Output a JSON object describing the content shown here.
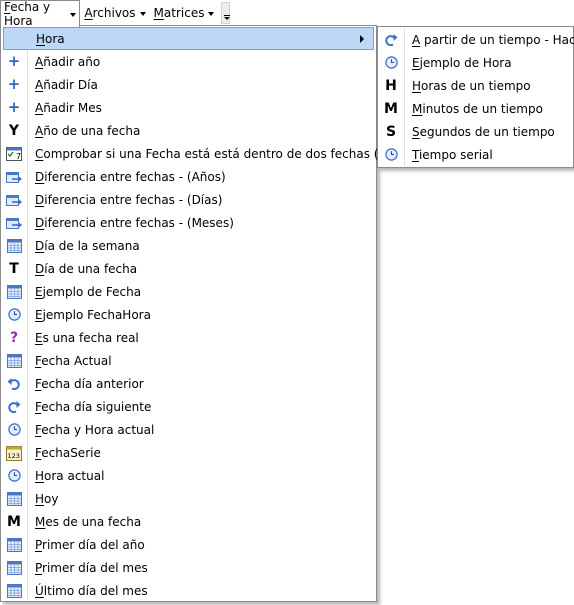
{
  "menubar": {
    "items": [
      {
        "label": "Fecha y Hora",
        "mnemonic": "F",
        "rest": "echa y Hora"
      },
      {
        "label": "Archivos",
        "mnemonic": "A",
        "rest": "rchivos"
      },
      {
        "label": "Matrices",
        "mnemonic": "M",
        "rest": "atrices"
      }
    ]
  },
  "main_menu": {
    "items": [
      {
        "icon": "none",
        "m": "H",
        "r": "ora",
        "has_submenu": true
      },
      {
        "icon": "plus-icon",
        "m": "A",
        "r": "ñadir año"
      },
      {
        "icon": "plus-icon",
        "m": "A",
        "r": "ñadir Día"
      },
      {
        "icon": "plus-icon",
        "m": "A",
        "r": "ñadir Mes"
      },
      {
        "icon": "y-letter-icon",
        "m": "A",
        "r": "ño de una fecha"
      },
      {
        "icon": "calendar-check-icon",
        "m": "C",
        "r": "omprobar si una Fecha está está dentro de dos fechas (fx)"
      },
      {
        "icon": "date-diff-icon",
        "m": "D",
        "r": "iferencia entre fechas - (Años)"
      },
      {
        "icon": "date-diff-icon",
        "m": "D",
        "r": "iferencia entre fechas - (Días)"
      },
      {
        "icon": "date-diff-icon",
        "m": "D",
        "r": "iferencia entre fechas - (Meses)"
      },
      {
        "icon": "calendar-icon",
        "m": "D",
        "r": "ía de la semana"
      },
      {
        "icon": "t-letter-icon",
        "m": "D",
        "r": "ía de una fecha"
      },
      {
        "icon": "calendar-icon",
        "m": "E",
        "r": "jemplo de Fecha"
      },
      {
        "icon": "clock-icon",
        "m": "E",
        "r": "jemplo FechaHora"
      },
      {
        "icon": "question-icon",
        "m": "E",
        "r": "s una fecha real"
      },
      {
        "icon": "calendar-icon",
        "m": "F",
        "r": "echa Actual"
      },
      {
        "icon": "undo-arrow-icon",
        "m": "F",
        "r": "echa día anterior"
      },
      {
        "icon": "redo-arrow-icon",
        "m": "F",
        "r": "echa día siguiente"
      },
      {
        "icon": "clock-icon",
        "m": "F",
        "r": "echa y Hora actual"
      },
      {
        "icon": "calendar-123-icon",
        "m": "F",
        "r": "echaSerie"
      },
      {
        "icon": "clock-icon",
        "m": "H",
        "r": "ora actual"
      },
      {
        "icon": "calendar-icon",
        "m": "H",
        "r": "oy"
      },
      {
        "icon": "m-letter-icon",
        "m": "M",
        "r": "es de una fecha"
      },
      {
        "icon": "calendar-icon",
        "m": "P",
        "r": "rimer día del año"
      },
      {
        "icon": "calendar-icon",
        "m": "P",
        "r": "rimer día del mes"
      },
      {
        "icon": "calendar-icon",
        "m": "Ú",
        "r": "ltimo día del mes"
      }
    ]
  },
  "sub_menu": {
    "items": [
      {
        "icon": "redo-arrow-icon",
        "m": "A",
        "r": " partir de un tiempo - Hacer"
      },
      {
        "icon": "clock-icon",
        "m": "E",
        "r": "jemplo de Hora"
      },
      {
        "icon": "h-letter-icon",
        "m": "H",
        "r": "oras de un tiempo"
      },
      {
        "icon": "m-letter-icon",
        "m": "M",
        "r": "inutos de un tiempo"
      },
      {
        "icon": "s-letter-icon",
        "m": "S",
        "r": "egundos de un tiempo"
      },
      {
        "icon": "clock-icon",
        "m": "T",
        "r": "iempo serial"
      }
    ]
  },
  "letters": {
    "y": "Y",
    "t": "T",
    "m": "M",
    "h": "H",
    "s": "S",
    "q": "?",
    "plus": "+",
    "cal_num": "7",
    "cal_123": "123"
  },
  "colors": {
    "highlight": "#bcd8f6",
    "highlight_border": "#6da4e0",
    "plus": "#2e66c9",
    "clock": "#3a6fd0",
    "question": "#9b27b5"
  }
}
